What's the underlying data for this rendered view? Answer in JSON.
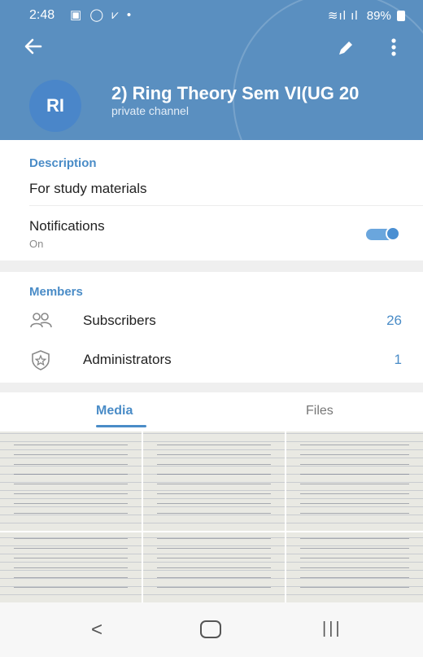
{
  "status_bar": {
    "time": "2:48",
    "battery": "89%"
  },
  "header": {
    "avatar_initials": "RI",
    "title": "2)  Ring Theory Sem VI(UG 20",
    "subtitle": "private channel",
    "bg_color": "#5a8fc0"
  },
  "description": {
    "heading": "Description",
    "text": "For study materials"
  },
  "notifications": {
    "label": "Notifications",
    "state": "On",
    "enabled": true
  },
  "members": {
    "heading": "Members",
    "rows": [
      {
        "label": "Subscribers",
        "count": "26",
        "icon": "people-icon"
      },
      {
        "label": "Administrators",
        "count": "1",
        "icon": "admin-star-shield-icon"
      }
    ]
  },
  "tabs": {
    "media": "Media",
    "files": "Files",
    "active": "Media"
  },
  "media_items": [
    "handwritten-notes",
    "handwritten-notes",
    "handwritten-notes",
    "handwritten-notes",
    "handwritten-notes",
    "handwritten-notes"
  ],
  "accent_color": "#4a8cc7"
}
